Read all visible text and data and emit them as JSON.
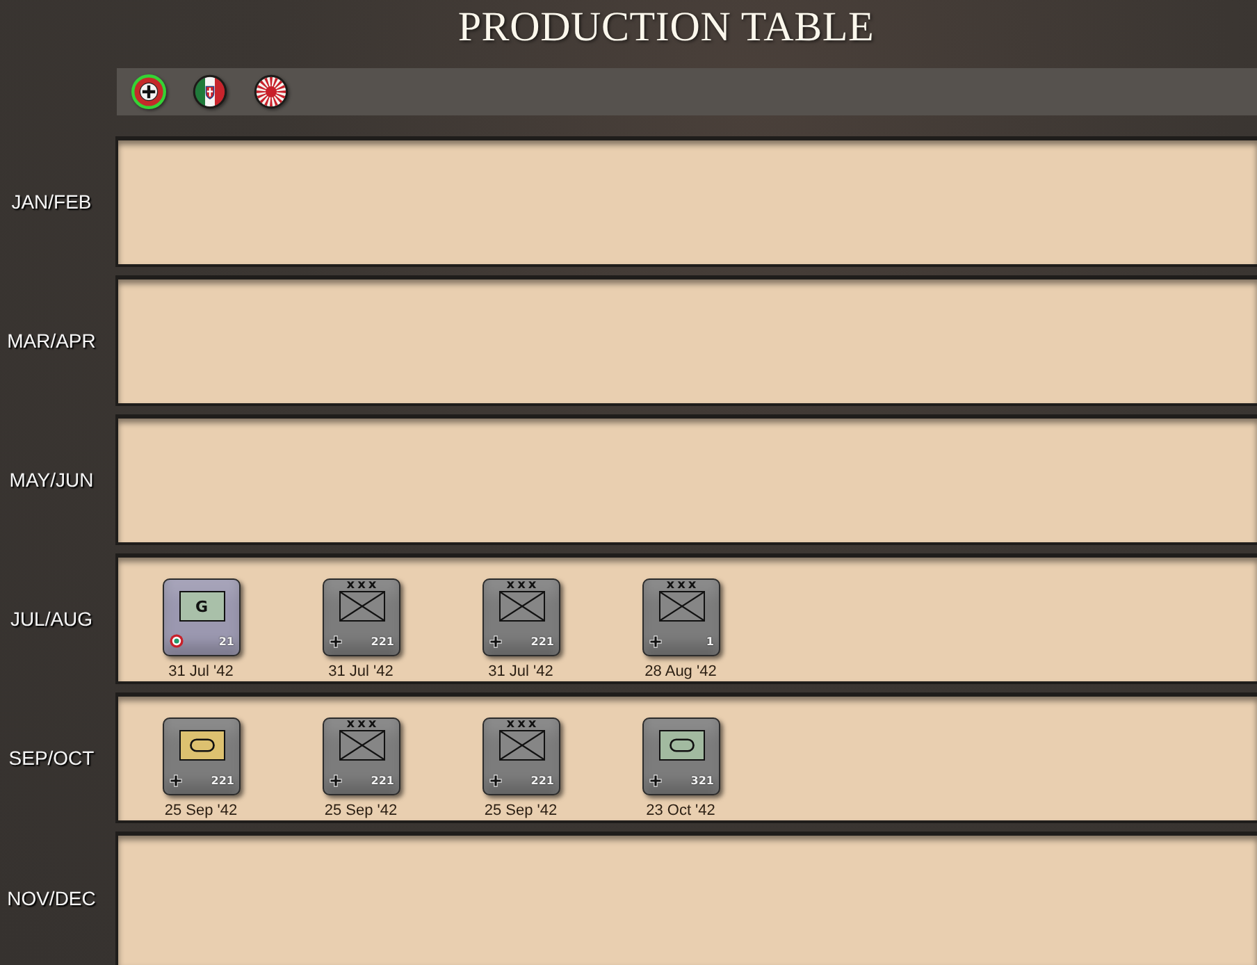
{
  "title": "PRODUCTION TABLE",
  "factions": [
    {
      "kind": "cross",
      "selected": true
    },
    {
      "kind": "tricolor",
      "selected": false
    },
    {
      "kind": "sun",
      "selected": false
    }
  ],
  "rows": [
    {
      "label": "JAN/FEB"
    },
    {
      "label": "MAR/APR"
    },
    {
      "label": "MAY/JUN"
    },
    {
      "label": "JUL/AUG",
      "units": [
        {
          "color": "#9b98b0",
          "symbol": {
            "kind": "letter",
            "label": "G",
            "color": "#a9c0a9"
          },
          "marker": {
            "kind": "roundel"
          },
          "number": "21",
          "date": "31 Jul '42"
        },
        {
          "color": "#7c7c7c",
          "size": "xxx",
          "symbol": {
            "kind": "infantry",
            "color": "#868686"
          },
          "marker": {
            "kind": "cross"
          },
          "number": "221",
          "date": "31 Jul '42"
        },
        {
          "color": "#7c7c7c",
          "size": "xxx",
          "symbol": {
            "kind": "infantry",
            "color": "#868686"
          },
          "marker": {
            "kind": "cross"
          },
          "number": "221",
          "date": "31 Jul '42"
        },
        {
          "color": "#7c7c7c",
          "size": "xxx",
          "symbol": {
            "kind": "infantry",
            "color": "#868686"
          },
          "marker": {
            "kind": "cross"
          },
          "number": "1",
          "date": "28 Aug '42"
        }
      ]
    },
    {
      "label": "SEP/OCT",
      "units": [
        {
          "color": "#7c7c7c",
          "symbol": {
            "kind": "armor",
            "color": "#ddc170"
          },
          "marker": {
            "kind": "cross"
          },
          "number": "221",
          "date": "25 Sep '42"
        },
        {
          "color": "#7c7c7c",
          "size": "xxx",
          "symbol": {
            "kind": "infantry",
            "color": "#868686"
          },
          "marker": {
            "kind": "cross"
          },
          "number": "221",
          "date": "25 Sep '42"
        },
        {
          "color": "#7c7c7c",
          "size": "xxx",
          "symbol": {
            "kind": "infantry",
            "color": "#868686"
          },
          "marker": {
            "kind": "cross"
          },
          "number": "221",
          "date": "25 Sep '42"
        },
        {
          "color": "#7c7c7c",
          "symbol": {
            "kind": "armor",
            "color": "#a2baa0"
          },
          "marker": {
            "kind": "cross"
          },
          "number": "321",
          "date": "23 Oct '42"
        }
      ]
    },
    {
      "label": "NOV/DEC"
    }
  ]
}
